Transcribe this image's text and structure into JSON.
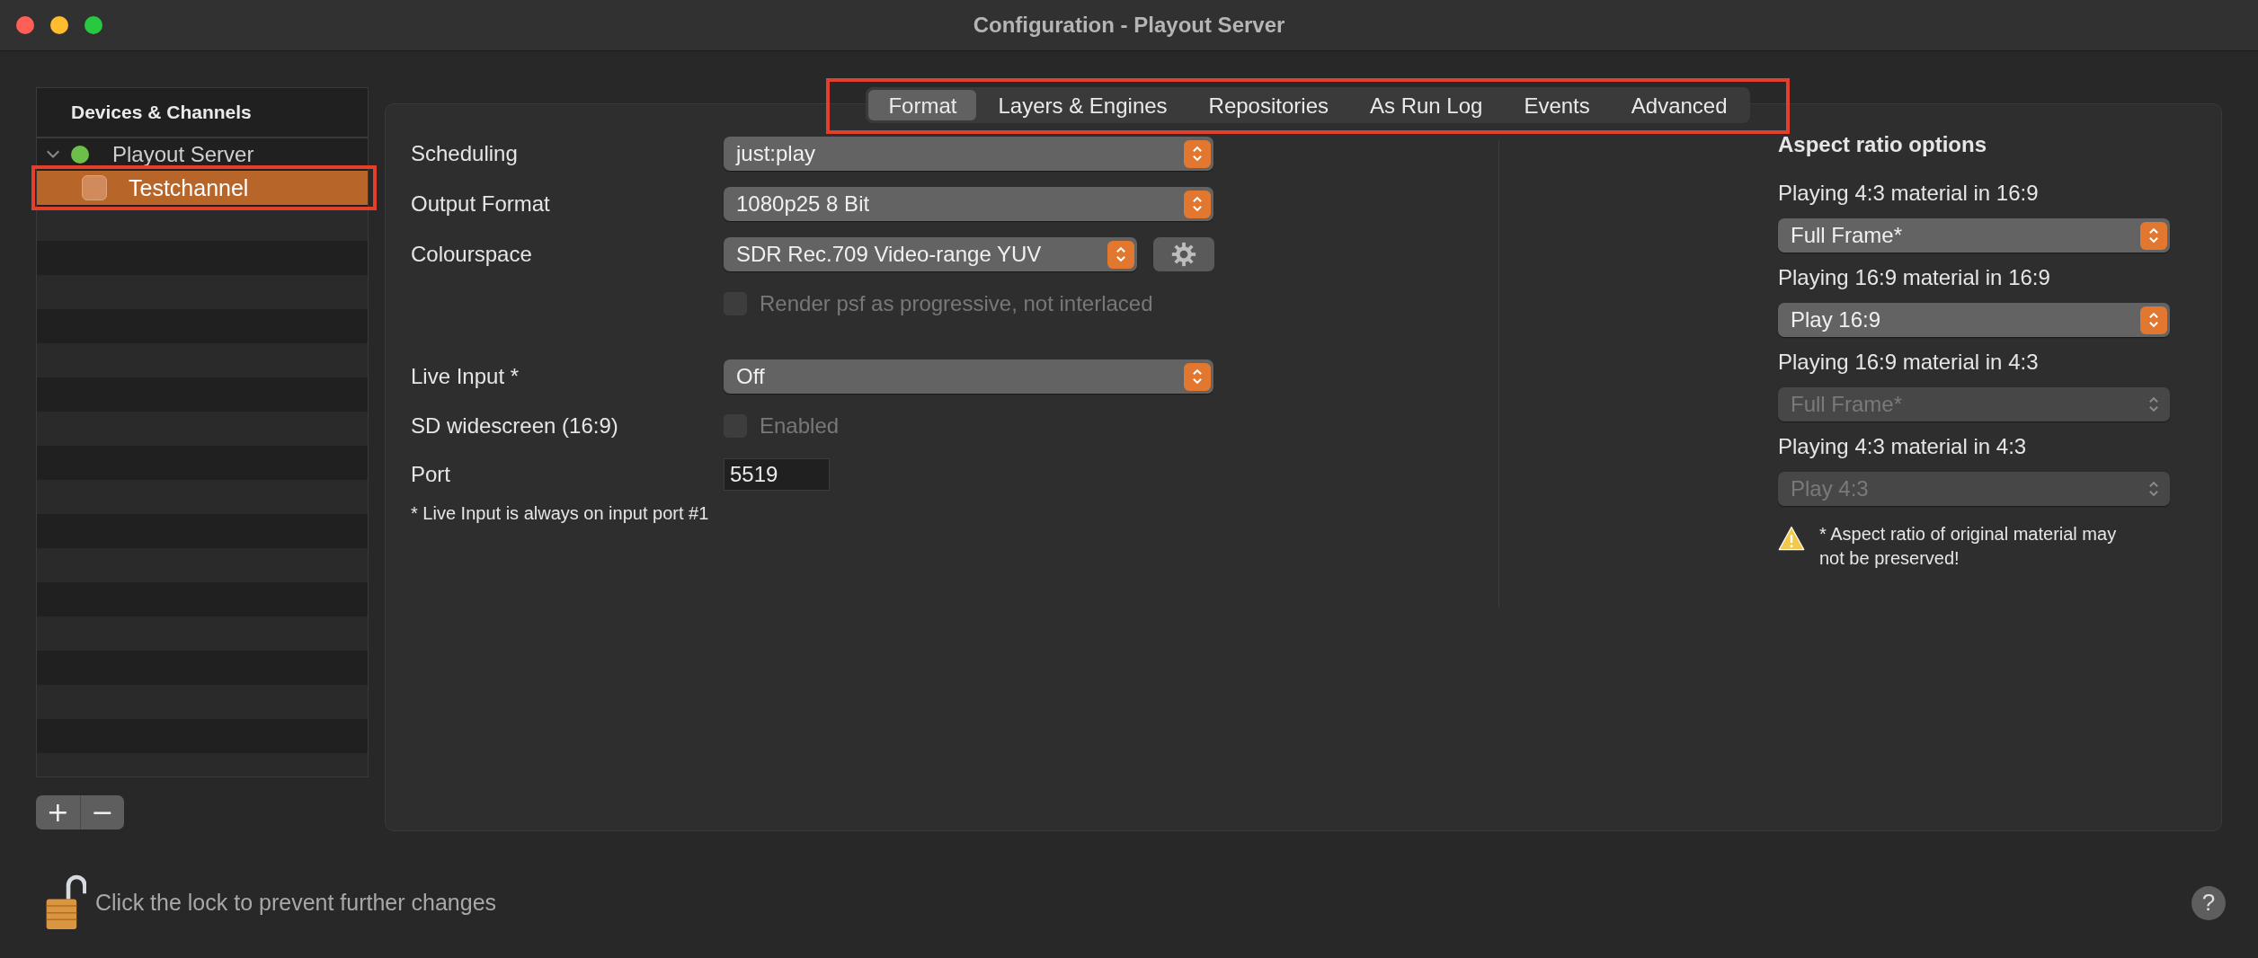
{
  "window": {
    "title": "Configuration - Playout Server"
  },
  "sidebar": {
    "header": "Devices & Channels",
    "items": [
      {
        "label": "Playout Server",
        "expanded": true,
        "color": "#6cc04a",
        "children": [
          {
            "label": "Testchannel",
            "selected": true,
            "highlighted": true
          }
        ]
      }
    ],
    "buttons": [
      "+",
      "−"
    ]
  },
  "tabs": {
    "highlighted": true,
    "items": [
      {
        "label": "Format",
        "selected": true
      },
      {
        "label": "Layers & Engines",
        "selected": false
      },
      {
        "label": "Repositories",
        "selected": false
      },
      {
        "label": "As Run Log",
        "selected": false
      },
      {
        "label": "Events",
        "selected": false
      },
      {
        "label": "Advanced",
        "selected": false
      }
    ]
  },
  "form": {
    "rows": [
      {
        "kind": "popup",
        "label": "Scheduling",
        "value": "just:play"
      },
      {
        "kind": "popup",
        "label": "Output Format",
        "value": "1080p25 8 Bit"
      },
      {
        "kind": "popup_gear",
        "label": "Colourspace",
        "value": "SDR Rec.709 Video-range YUV"
      },
      {
        "kind": "checkbox",
        "text": "Render psf as progressive, not interlaced",
        "checked": false,
        "disabled": true
      },
      {
        "kind": "popup",
        "label": "Live Input *",
        "value": "Off"
      },
      {
        "kind": "checkbox",
        "label": "SD widescreen (16:9)",
        "text": "Enabled",
        "checked": false,
        "disabled": true
      },
      {
        "kind": "field",
        "label": "Port",
        "value": "5519"
      }
    ],
    "footnote": "* Live Input is always on input port #1"
  },
  "aspect": {
    "heading": "Aspect ratio options",
    "options": [
      {
        "label": "Playing 4:3 material in 16:9",
        "value": "Full Frame*",
        "disabled": false
      },
      {
        "label": "Playing 16:9 material in 16:9",
        "value": "Play 16:9",
        "disabled": false
      },
      {
        "label": "Playing 16:9 material in 4:3",
        "value": "Full Frame*",
        "disabled": true
      },
      {
        "label": "Playing 4:3 material in 4:3",
        "value": "Play 4:3",
        "disabled": true
      }
    ],
    "warning": "* Aspect ratio of original material may not be preserved!"
  },
  "footer": {
    "lock_text": "Click the lock to prevent further changes",
    "help": "?"
  }
}
